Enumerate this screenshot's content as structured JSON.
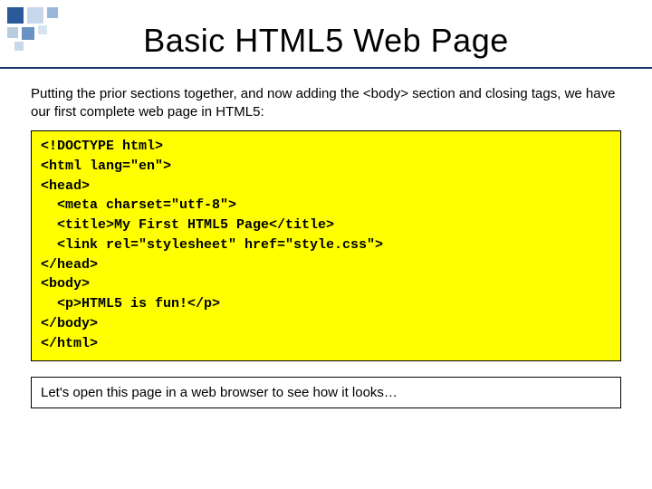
{
  "title": "Basic HTML5 Web Page",
  "intro": "Putting the prior sections together, and now adding the <body> section and closing tags, we have our first complete web page in HTML5:",
  "code": "<!DOCTYPE html>\n<html lang=\"en\">\n<head>\n  <meta charset=\"utf-8\">\n  <title>My First HTML5 Page</title>\n  <link rel=\"stylesheet\" href=\"style.css\">\n</head>\n<body>\n  <p>HTML5 is fun!</p>\n</body>\n</html>",
  "footer": "Let's open this page in a web browser to see how it looks…"
}
